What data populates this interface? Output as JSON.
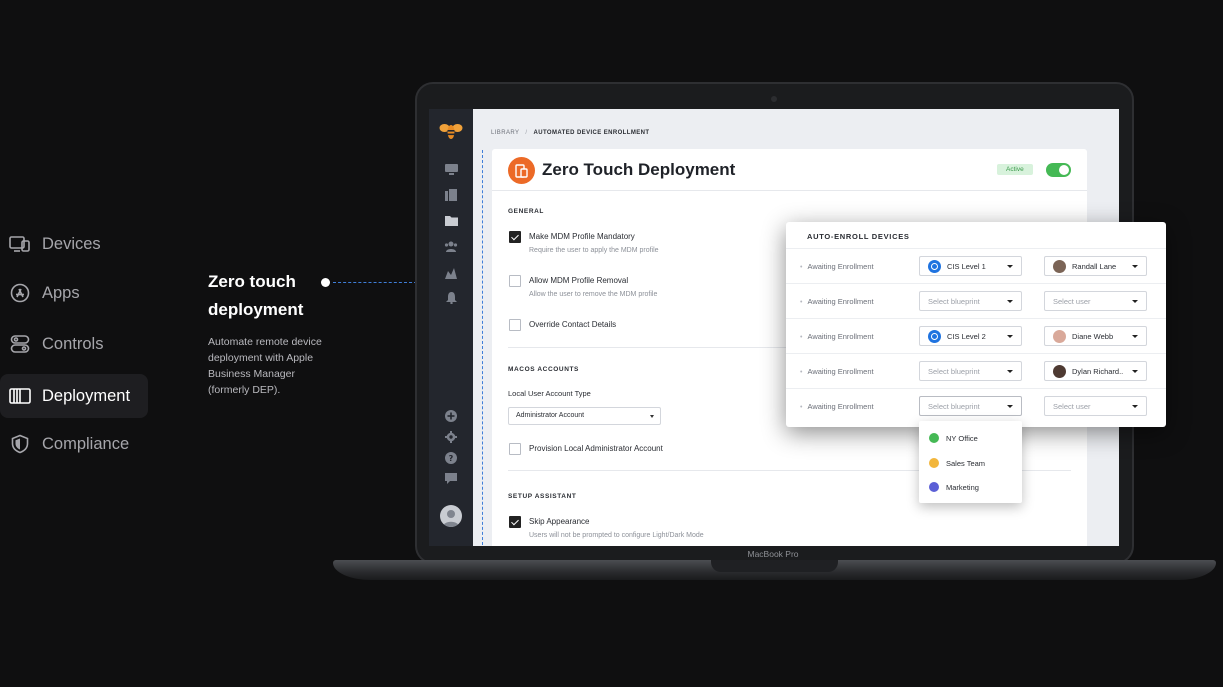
{
  "feature_nav": {
    "items": [
      {
        "label": "Devices",
        "icon": "devices-icon",
        "active": false
      },
      {
        "label": "Apps",
        "icon": "app-store-icon",
        "active": false
      },
      {
        "label": "Controls",
        "icon": "controls-icon",
        "active": false
      },
      {
        "label": "Deployment",
        "icon": "deployment-icon",
        "active": true
      },
      {
        "label": "Compliance",
        "icon": "shield-icon",
        "active": false
      }
    ]
  },
  "callout": {
    "title": "Zero touch deployment",
    "description": "Automate remote device deployment with Apple Business Manager (formerly DEP)."
  },
  "laptop": {
    "brand": "MacBook Pro"
  },
  "app": {
    "breadcrumb": {
      "root": "LIBRARY",
      "separator": "/",
      "current": "AUTOMATED DEVICE ENROLLMENT"
    },
    "title": "Zero Touch Deployment",
    "status_badge": "Active",
    "toggle_on": true,
    "general": {
      "label": "GENERAL",
      "options": [
        {
          "label": "Make MDM Profile Mandatory",
          "sub": "Require the user to apply the MDM profile",
          "checked": true
        },
        {
          "label": "Allow MDM Profile Removal",
          "sub": "Allow the user to remove the MDM profile",
          "checked": false
        },
        {
          "label": "Override Contact Details",
          "sub": "",
          "checked": false
        }
      ]
    },
    "macos_accounts": {
      "label": "MACOS ACCOUNTS",
      "field_label": "Local User Account Type",
      "select_value": "Administrator Account",
      "option": {
        "label": "Provision Local Administrator Account",
        "checked": false
      }
    },
    "setup_assistant": {
      "label": "SETUP ASSISTANT",
      "option": {
        "label": "Skip Appearance",
        "sub": "Users will not be prompted to configure Light/Dark Mode",
        "checked": true
      }
    }
  },
  "auto_enroll": {
    "title": "AUTO-ENROLL DEVICES",
    "blueprint_placeholder": "Select blueprint",
    "user_placeholder": "Select user",
    "rows": [
      {
        "status": "Awaiting Enrollment",
        "blueprint": "CIS Level 1",
        "user": "Randall Lane"
      },
      {
        "status": "Awaiting Enrollment",
        "blueprint": "",
        "user": ""
      },
      {
        "status": "Awaiting Enrollment",
        "blueprint": "CIS Level 2",
        "user": "Diane Webb"
      },
      {
        "status": "Awaiting Enrollment",
        "blueprint": "",
        "user": "Dylan Richard.."
      },
      {
        "status": "Awaiting Enrollment",
        "blueprint": "",
        "user": ""
      }
    ]
  },
  "blueprint_dropdown": {
    "items": [
      {
        "label": "NY Office",
        "color": "#45b955"
      },
      {
        "label": "Sales Team",
        "color": "#f2b63c"
      },
      {
        "label": "Marketing",
        "color": "#5b5fd6"
      }
    ]
  },
  "colors": {
    "background": "#0f0f10",
    "accent_blue": "#3f7ed8",
    "active_green": "#45b955",
    "brand_orange": "#ec6a27"
  }
}
